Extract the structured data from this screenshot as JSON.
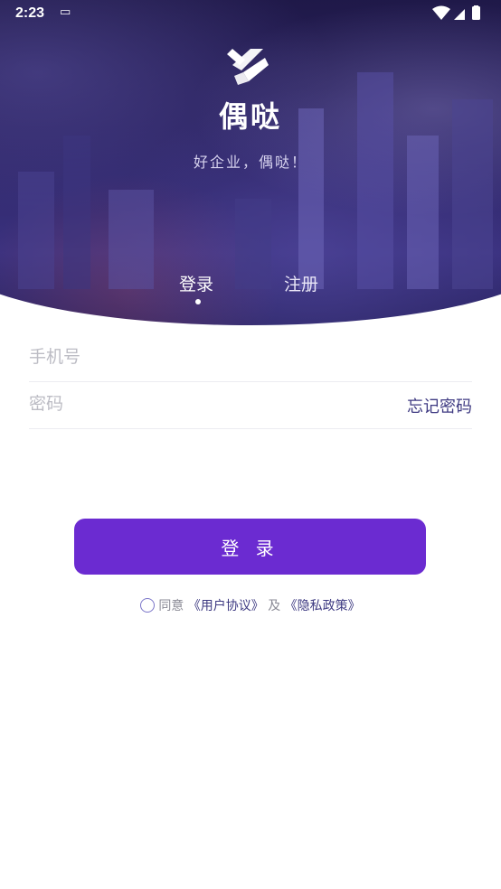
{
  "status_bar": {
    "time": "2:23"
  },
  "brand": {
    "name": "偶哒",
    "slogan": "好企业，偶哒！"
  },
  "tabs": [
    {
      "label": "登录"
    },
    {
      "label": "注册"
    }
  ],
  "form": {
    "phone_placeholder": "手机号",
    "password_placeholder": "密码",
    "forgot_password": "忘记密码"
  },
  "login_button": {
    "label": "登 录"
  },
  "agreement": {
    "prefix": "同意",
    "user_agreement": "《用户协议》",
    "and": "及",
    "privacy_policy": "《隐私政策》"
  },
  "colors": {
    "accent": "#6b2bd1",
    "link": "#3e3a82",
    "hero": "#2a2260"
  }
}
